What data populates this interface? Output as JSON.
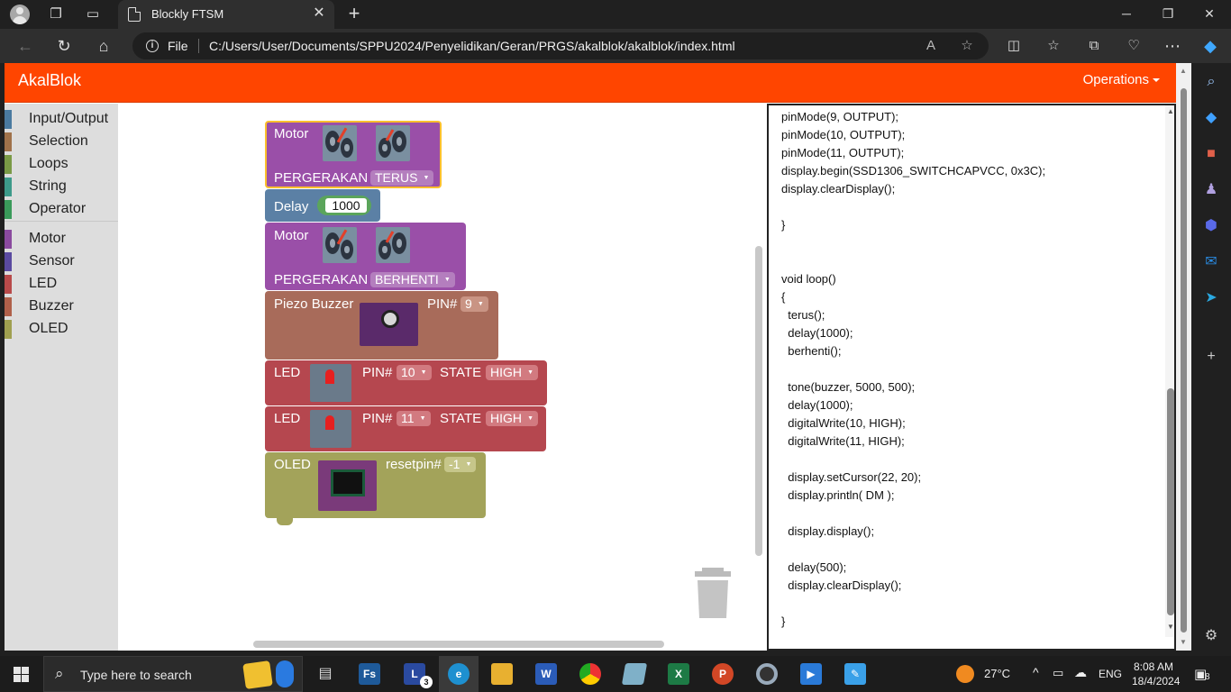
{
  "browser": {
    "tab_title": "Blockly FTSM",
    "tab_close": "✕",
    "new_tab": "+",
    "file_label": "File",
    "url": "C:/Users/User/Documents/SPPU2024/Penyelidikan/Geran/PRGS/akalblok/akalblok/index.html"
  },
  "app": {
    "brand": "AkalBlok",
    "operations_menu": "Operations"
  },
  "toolbox": {
    "categories": [
      {
        "label": "Input/Output",
        "color": "#4a7aa0"
      },
      {
        "label": "Selection",
        "color": "#a0724a"
      },
      {
        "label": "Loops",
        "color": "#7a9a46"
      },
      {
        "label": "String",
        "color": "#3d9a8a"
      },
      {
        "label": "Operator",
        "color": "#3a9a5a"
      },
      {
        "label": "Motor",
        "color": "#8a4a9e"
      },
      {
        "label": "Sensor",
        "color": "#5a4aa0"
      },
      {
        "label": "LED",
        "color": "#b84a4a"
      },
      {
        "label": "Buzzer",
        "color": "#b0604a"
      },
      {
        "label": "OLED",
        "color": "#a0a050"
      }
    ]
  },
  "blocks": {
    "motor1": {
      "title": "Motor",
      "label": "PERGERAKAN",
      "value": "TERUS"
    },
    "delay": {
      "title": "Delay",
      "value": "1000"
    },
    "motor2": {
      "title": "Motor",
      "label": "PERGERAKAN",
      "value": "BERHENTI"
    },
    "buzzer": {
      "title": "Piezo Buzzer",
      "pin_label": "PIN#",
      "pin": "9"
    },
    "led1": {
      "title": "LED",
      "pin_label": "PIN#",
      "pin": "10",
      "state_label": "STATE",
      "state": "HIGH"
    },
    "led2": {
      "title": "LED",
      "pin_label": "PIN#",
      "pin": "11",
      "state_label": "STATE",
      "state": "HIGH"
    },
    "oled": {
      "title": "OLED",
      "reset_label": "resetpin#",
      "reset": "-1"
    }
  },
  "code": {
    "lines": [
      "pinMode(9, OUTPUT);",
      "pinMode(10, OUTPUT);",
      "pinMode(11, OUTPUT);",
      "display.begin(SSD1306_SWITCHCAPVCC, 0x3C);",
      "display.clearDisplay();",
      "",
      "}",
      "",
      "",
      "void loop()",
      "{",
      "  terus();",
      "  delay(1000);",
      "  berhenti();",
      "",
      "  tone(buzzer, 5000, 500);",
      "  delay(1000);",
      "  digitalWrite(10, HIGH);",
      "  digitalWrite(11, HIGH);",
      "",
      "  display.setCursor(22, 20);",
      "  display.println( DM );",
      "",
      "  display.display();",
      "",
      "  delay(500);",
      "  display.clearDisplay();",
      "",
      "}"
    ]
  },
  "taskbar": {
    "search_placeholder": "Type here to search",
    "weather": "27°C",
    "language": "ENG",
    "time": "8:08 AM",
    "date": "18/4/2024",
    "notification_count": "8",
    "l_badge": "3",
    "apps": [
      "task-view",
      "fs",
      "l-app",
      "edge",
      "file-explorer",
      "word",
      "chrome",
      "notes",
      "excel",
      "powerpoint",
      "app-circle",
      "media",
      "paint"
    ]
  },
  "colors": {
    "app_bar": "#ff4500",
    "motor_block": "#9a4fa8",
    "delay_block": "#5b80a5",
    "buzzer_block": "#a86b5a",
    "led_block": "#b5474f",
    "oled_block": "#a3a35a",
    "selected_outline": "#fbc02d"
  }
}
